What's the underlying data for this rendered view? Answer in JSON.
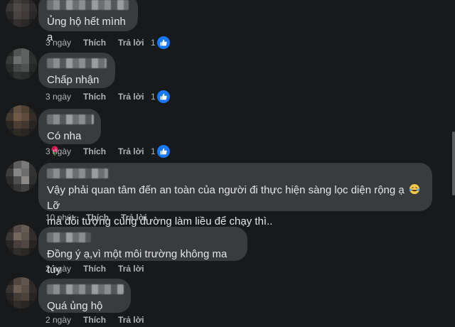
{
  "comments": [
    {
      "text": "Ủng hộ hết mình ạ",
      "time": "3 ngày",
      "like_label": "Thích",
      "reply_label": "Trả lời",
      "reaction_count": "1"
    },
    {
      "text": "Chấp nhận",
      "time": "3 ngày",
      "like_label": "Thích",
      "reply_label": "Trả lời",
      "reaction_count": "1"
    },
    {
      "text": "Có nha",
      "time": "3 ngày",
      "like_label": "Thích",
      "reply_label": "Trả lời",
      "reaction_count": "1"
    },
    {
      "text_line1": "Vậy phải quan tâm đến an toàn của người đi thực hiện sàng lọc diện rộng ạ",
      "text_line1_end": "Lỡ",
      "text_line2": "mà đối tượng cùng đường làm liều để chạy thì..",
      "time": "10 phút",
      "like_label": "Thích",
      "reply_label": "Trả lời"
    },
    {
      "text": "Đồng ý ạ,vì một môi trường không ma túy",
      "time": "2 ngày",
      "like_label": "Thích",
      "reply_label": "Trả lời"
    },
    {
      "text": "Quá ủng hộ",
      "time": "2 ngày",
      "like_label": "Thích",
      "reply_label": "Trả lời"
    }
  ],
  "colors": {
    "background": "#18191a",
    "bubble": "#3a3b3c",
    "text": "#e4e6eb",
    "meta": "#b0b3b8",
    "like_blue": "#1877f2"
  },
  "icons": {
    "like": "thumbs-up-icon",
    "rose": "rose-emoji-icon",
    "laugh": "laughing-tears-emoji-icon"
  }
}
